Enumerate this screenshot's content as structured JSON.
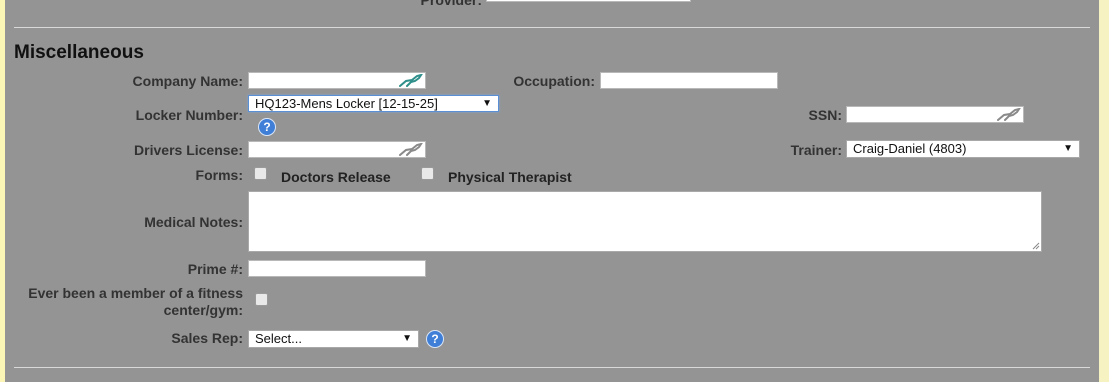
{
  "provider": {
    "label": "Provider:"
  },
  "section": {
    "title": "Miscellaneous"
  },
  "fields": {
    "company_name": {
      "label": "Company Name:",
      "value": ""
    },
    "occupation": {
      "label": "Occupation:",
      "value": ""
    },
    "locker_number": {
      "label": "Locker Number:",
      "selected": "HQ123-Mens Locker [12-15-25]"
    },
    "ssn": {
      "label": "SSN:",
      "value": ""
    },
    "drivers_license": {
      "label": "Drivers License:",
      "value": ""
    },
    "trainer": {
      "label": "Trainer:",
      "selected": "Craig-Daniel (4803)"
    },
    "forms": {
      "label": "Forms:",
      "options": [
        {
          "label": "Doctors Release",
          "checked": false
        },
        {
          "label": "Physical Therapist",
          "checked": false
        }
      ]
    },
    "medical_notes": {
      "label": "Medical Notes:",
      "value": ""
    },
    "prime": {
      "label": "Prime #:",
      "value": ""
    },
    "fitness_member": {
      "label": "Ever been a member of a fitness center/gym:",
      "checked": false
    },
    "sales_rep": {
      "label": "Sales Rep:",
      "selected": "Select..."
    }
  },
  "icons": {
    "help": "help-circle-icon",
    "autofill": "gazelle-autofill-icon"
  },
  "colors": {
    "background": "#949494",
    "accent": "#3f7fd8",
    "icon_teal": "#2f8f8a"
  }
}
